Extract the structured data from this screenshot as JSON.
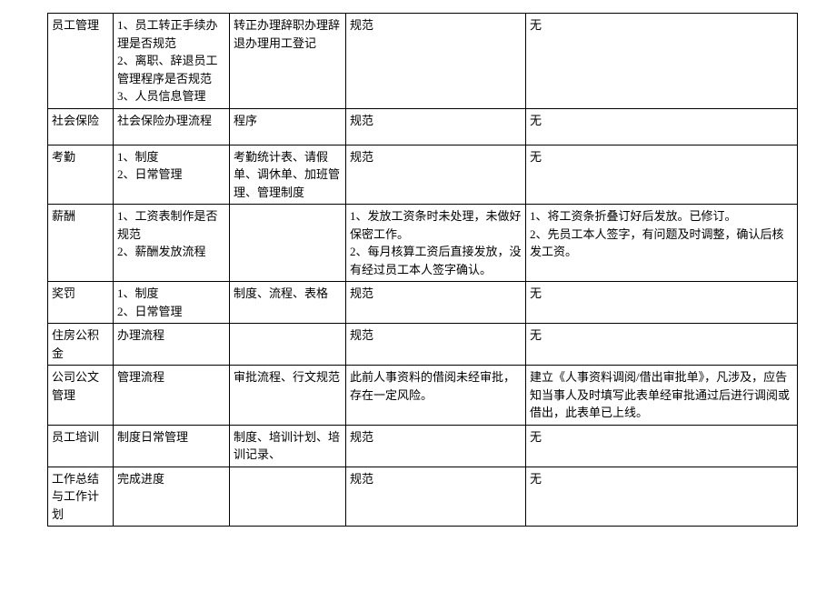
{
  "rows": [
    {
      "c0": "员工管理",
      "c1": "1、员工转正手续办理是否规范\n2、离职、辞退员工管理程序是否规范\n3、人员信息管理",
      "c2": "转正办理辞职办理辞退办理用工登记",
      "c3": "规范",
      "c4": "无"
    },
    {
      "c0": "社会保险",
      "c1": "社会保险办理流程",
      "c2": "程序",
      "c3": "规范",
      "c4": "无"
    },
    {
      "c0": "考勤",
      "c1": "1、制度\n2、日常管理",
      "c2": "考勤统计表、请假单、调休单、加班管理、管理制度",
      "c3": "规范",
      "c4": "无"
    },
    {
      "c0": "薪酬",
      "c1": "1、工资表制作是否规范\n2、薪酬发放流程",
      "c2": "",
      "c3": "1、发放工资条时未处理，未做好保密工作。\n2、每月核算工资后直接发放，没有经过员工本人签字确认。",
      "c4": "1、将工资条折叠订好后发放。已修订。\n2、先员工本人签字，有问题及时调整，确认后核发工资。"
    },
    {
      "c0": "奖罚",
      "c1": "1、制度\n2、日常管理",
      "c2": "制度、流程、表格",
      "c3": "规范",
      "c4": "无"
    },
    {
      "c0": "住房公积金",
      "c1": "办理流程",
      "c2": "",
      "c3": "规范",
      "c4": "无"
    },
    {
      "c0": "公司公文管理",
      "c1": "管理流程",
      "c2": "审批流程、行文规范",
      "c3": "此前人事资料的借阅未经审批，存在一定风险。",
      "c4": "建立《人事资料调阅/借出审批单》，凡涉及，应告知当事人及时填写此表单经审批通过后进行调阅或借出，此表单已上线。"
    },
    {
      "c0": "员工培训",
      "c1": "制度日常管理",
      "c2": "制度、培训计划、培训记录、",
      "c3": "规范",
      "c4": "无"
    },
    {
      "c0": "工作总结与工作计\n划",
      "c1": "完成进度",
      "c2": "",
      "c3": "规范",
      "c4": "无"
    }
  ]
}
